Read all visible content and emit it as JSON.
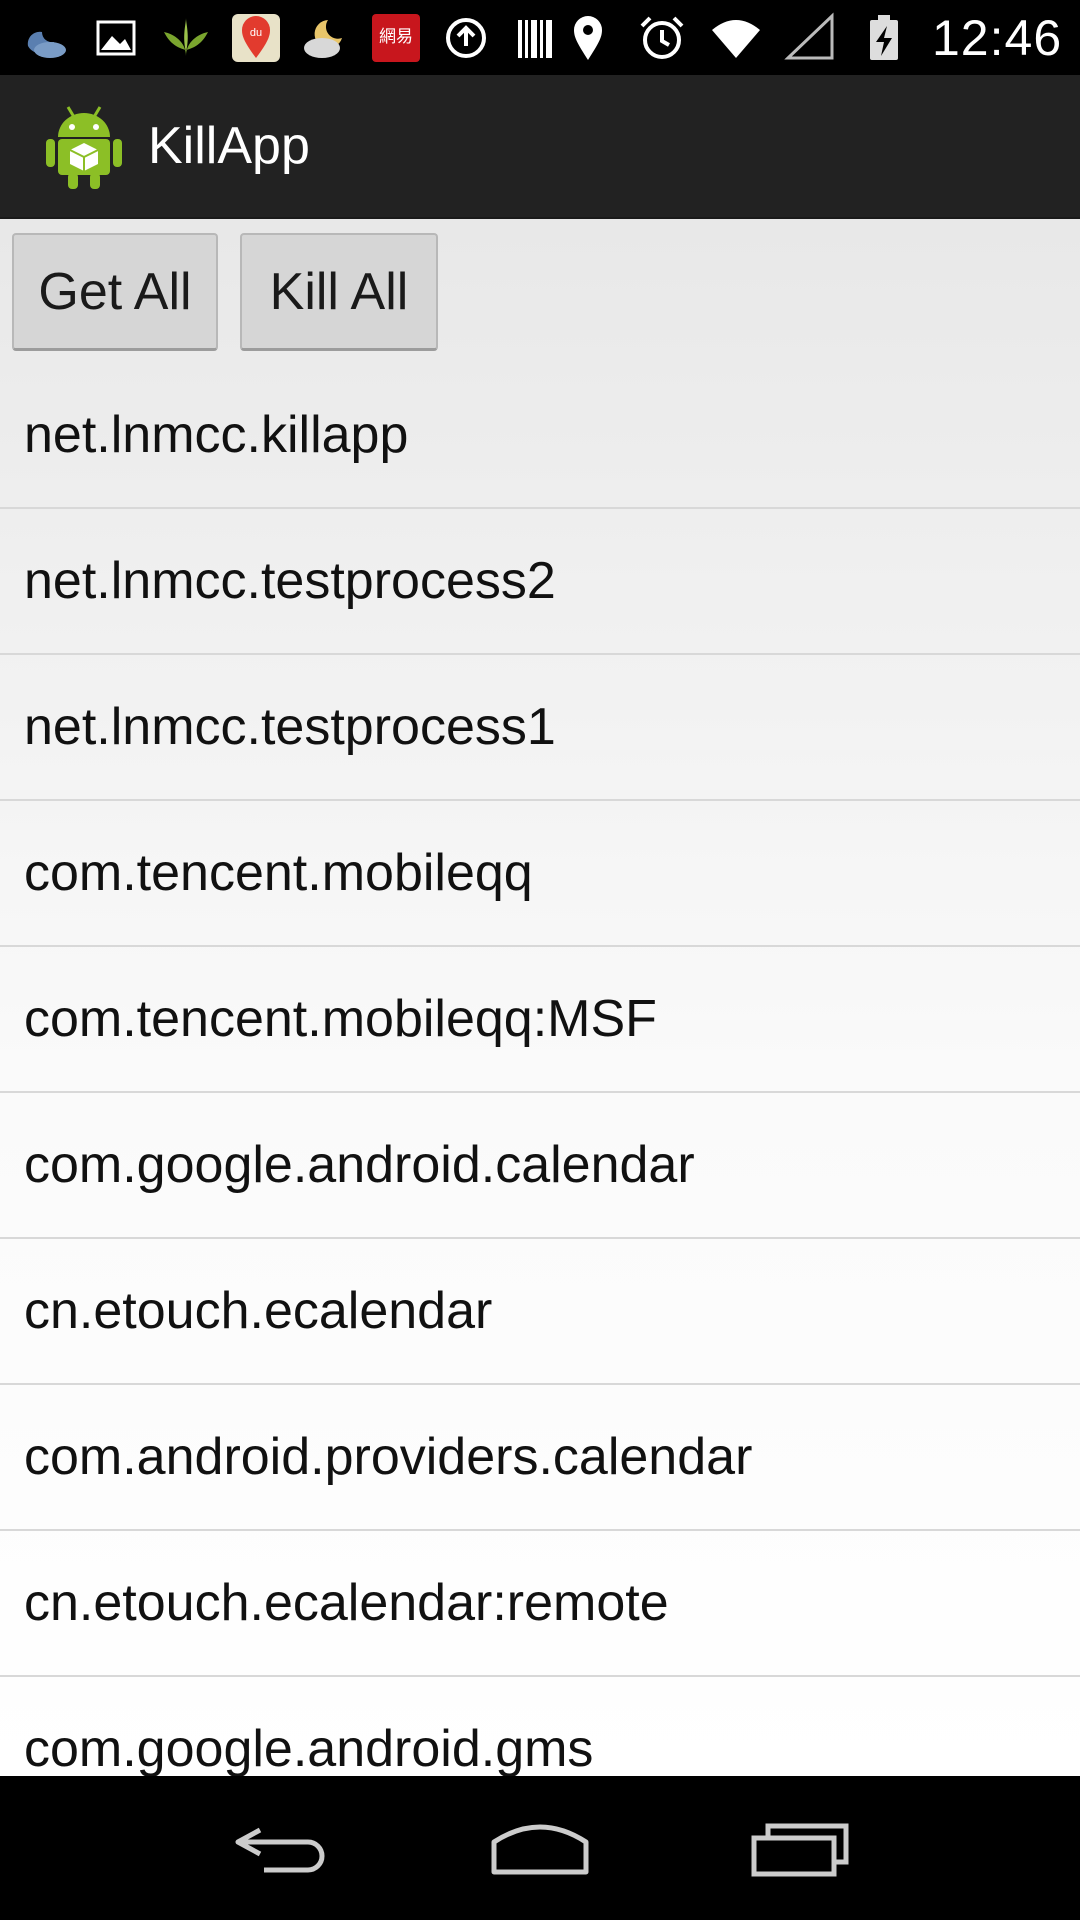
{
  "status_bar": {
    "time": "12:46",
    "left_icons": [
      "weather-moon-icon",
      "gallery-icon",
      "plant-icon",
      "baidu-maps-icon",
      "weather-cloud-moon-icon",
      "netease-icon",
      "sync-icon",
      "barcode-icon"
    ],
    "right_icons": [
      "location-icon",
      "alarm-icon",
      "wifi-icon",
      "signal-icon",
      "battery-charging-icon"
    ]
  },
  "action_bar": {
    "title": "KillApp",
    "icon": "android-app-icon"
  },
  "buttons": {
    "get_all": "Get All",
    "kill_all": "Kill All"
  },
  "processes": [
    "net.lnmcc.killapp",
    "net.lnmcc.testprocess2",
    "net.lnmcc.testprocess1",
    "com.tencent.mobileqq",
    "com.tencent.mobileqq:MSF",
    "com.google.android.calendar",
    "cn.etouch.ecalendar",
    "com.android.providers.calendar",
    "cn.etouch.ecalendar:remote",
    "com.google.android.gms"
  ],
  "nav_bar": {
    "icons": [
      "back-icon",
      "home-icon",
      "recents-icon"
    ]
  },
  "colors": {
    "action_bar": "#222222",
    "status_bar": "#000000",
    "button_bg": "#d6d6d6",
    "android_green": "#8cbf26"
  }
}
